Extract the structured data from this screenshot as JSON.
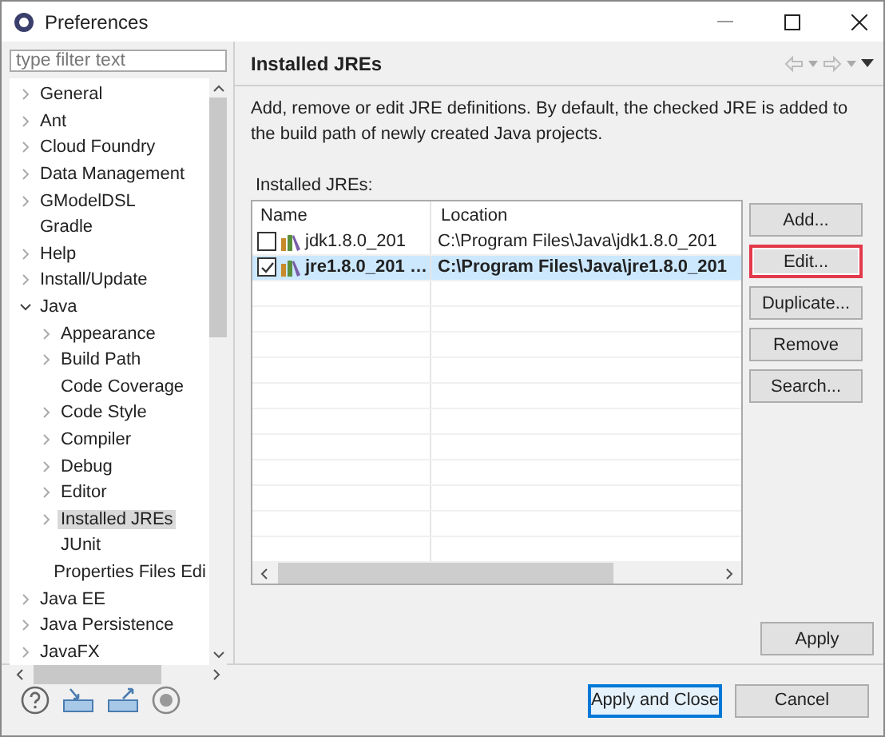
{
  "window": {
    "title": "Preferences"
  },
  "filter": {
    "placeholder": "type filter text"
  },
  "tree": [
    {
      "label": "General",
      "kind": "node",
      "expanded": false,
      "selected": false
    },
    {
      "label": "Ant",
      "kind": "node",
      "expanded": false,
      "selected": false
    },
    {
      "label": "Cloud Foundry",
      "kind": "node",
      "expanded": false,
      "selected": false
    },
    {
      "label": "Data Management",
      "kind": "node",
      "expanded": false,
      "selected": false
    },
    {
      "label": "GModelDSL",
      "kind": "node",
      "expanded": false,
      "selected": false
    },
    {
      "label": "Gradle",
      "kind": "leaf",
      "selected": false
    },
    {
      "label": "Help",
      "kind": "node",
      "expanded": false,
      "selected": false
    },
    {
      "label": "Install/Update",
      "kind": "node",
      "expanded": false,
      "selected": false
    },
    {
      "label": "Java",
      "kind": "node",
      "expanded": true,
      "selected": false,
      "children": [
        {
          "label": "Appearance",
          "kind": "node",
          "expanded": false,
          "selected": false
        },
        {
          "label": "Build Path",
          "kind": "node",
          "expanded": false,
          "selected": false
        },
        {
          "label": "Code Coverage",
          "kind": "leaf",
          "selected": false
        },
        {
          "label": "Code Style",
          "kind": "node",
          "expanded": false,
          "selected": false
        },
        {
          "label": "Compiler",
          "kind": "node",
          "expanded": false,
          "selected": false
        },
        {
          "label": "Debug",
          "kind": "node",
          "expanded": false,
          "selected": false
        },
        {
          "label": "Editor",
          "kind": "node",
          "expanded": false,
          "selected": false
        },
        {
          "label": "Installed JREs",
          "kind": "node",
          "expanded": false,
          "selected": true
        },
        {
          "label": "JUnit",
          "kind": "leaf",
          "selected": false
        },
        {
          "label": "Properties Files Edi",
          "kind": "leaf",
          "selected": false
        }
      ]
    },
    {
      "label": "Java EE",
      "kind": "node",
      "expanded": false,
      "selected": false
    },
    {
      "label": "Java Persistence",
      "kind": "node",
      "expanded": false,
      "selected": false
    },
    {
      "label": "JavaFX",
      "kind": "node",
      "expanded": false,
      "selected": false
    }
  ],
  "page": {
    "title": "Installed JREs",
    "description": "Add, remove or edit JRE definitions. By default, the checked JRE is added to the build path of newly created Java projects.",
    "list_label": "Installed JREs:"
  },
  "table": {
    "columns": [
      "Name",
      "Location"
    ],
    "rows": [
      {
        "name": "jdk1.8.0_201",
        "location": "C:\\Program Files\\Java\\jdk1.8.0_201",
        "checked": false,
        "selected": false
      },
      {
        "name": "jre1.8.0_201 …",
        "location": "C:\\Program Files\\Java\\jre1.8.0_201",
        "checked": true,
        "selected": true
      }
    ]
  },
  "side_buttons": [
    {
      "label": "Add...",
      "marked": false
    },
    {
      "label": "Edit...",
      "marked": true
    },
    {
      "label": "Duplicate...",
      "marked": false
    },
    {
      "label": "Remove",
      "marked": false
    },
    {
      "label": "Search...",
      "marked": false
    }
  ],
  "apply": "Apply",
  "footer_buttons": [
    {
      "label": "Apply and Close",
      "default": true
    },
    {
      "label": "Cancel",
      "default": false
    }
  ]
}
